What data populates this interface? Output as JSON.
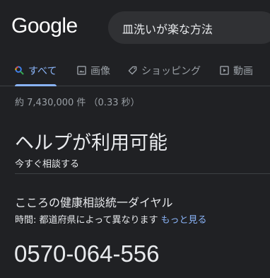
{
  "header": {
    "logo": "Google",
    "search_query": "皿洗いが楽な方法"
  },
  "tabs": [
    {
      "label": "すべて",
      "icon": "search-icon",
      "active": true
    },
    {
      "label": "画像",
      "icon": "image-icon",
      "active": false
    },
    {
      "label": "ショッピング",
      "icon": "tag-icon",
      "active": false
    },
    {
      "label": "動画",
      "icon": "play-icon",
      "active": false
    }
  ],
  "results_stats": "約 7,430,000 件 （0.33 秒）",
  "help_card": {
    "title": "ヘルプが利用可能",
    "subtitle": "今すぐ相談する",
    "org_name": "こころの健康相談統一ダイヤル",
    "hours_label": "時間: 都道府県によって異なります",
    "more_link": "もっと見る",
    "phone": "0570-064-556"
  },
  "colors": {
    "background": "#202124",
    "accent": "#8ab4f8",
    "text": "#e8eaed",
    "muted": "#9aa0a6",
    "search_box": "#303134"
  }
}
